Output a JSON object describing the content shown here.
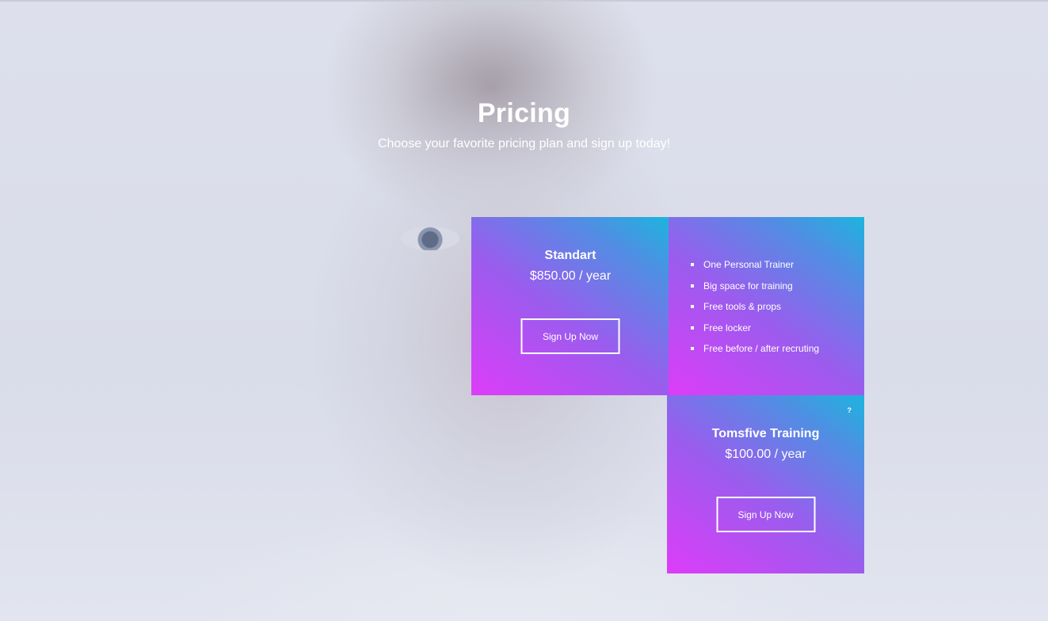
{
  "hero": {
    "title": "Pricing",
    "subtitle": "Choose your favorite pricing plan and sign up today!"
  },
  "plans": [
    {
      "name": "Standart",
      "price": "$850.00 / year",
      "button_label": "Sign Up Now"
    },
    {
      "name": "Tomsfive Training",
      "price": "$100.00 / year",
      "button_label": "Sign Up Now",
      "badge": "?"
    }
  ],
  "features": [
    "One Personal Trainer",
    "Big space for training",
    "Free tools & props",
    "Free locker",
    "Free before / after recruting"
  ],
  "colors": {
    "gradient_pink": "#dd3cf8",
    "gradient_purple": "#9b5cee",
    "gradient_cyan": "#1cb5de",
    "text": "#ffffff"
  }
}
